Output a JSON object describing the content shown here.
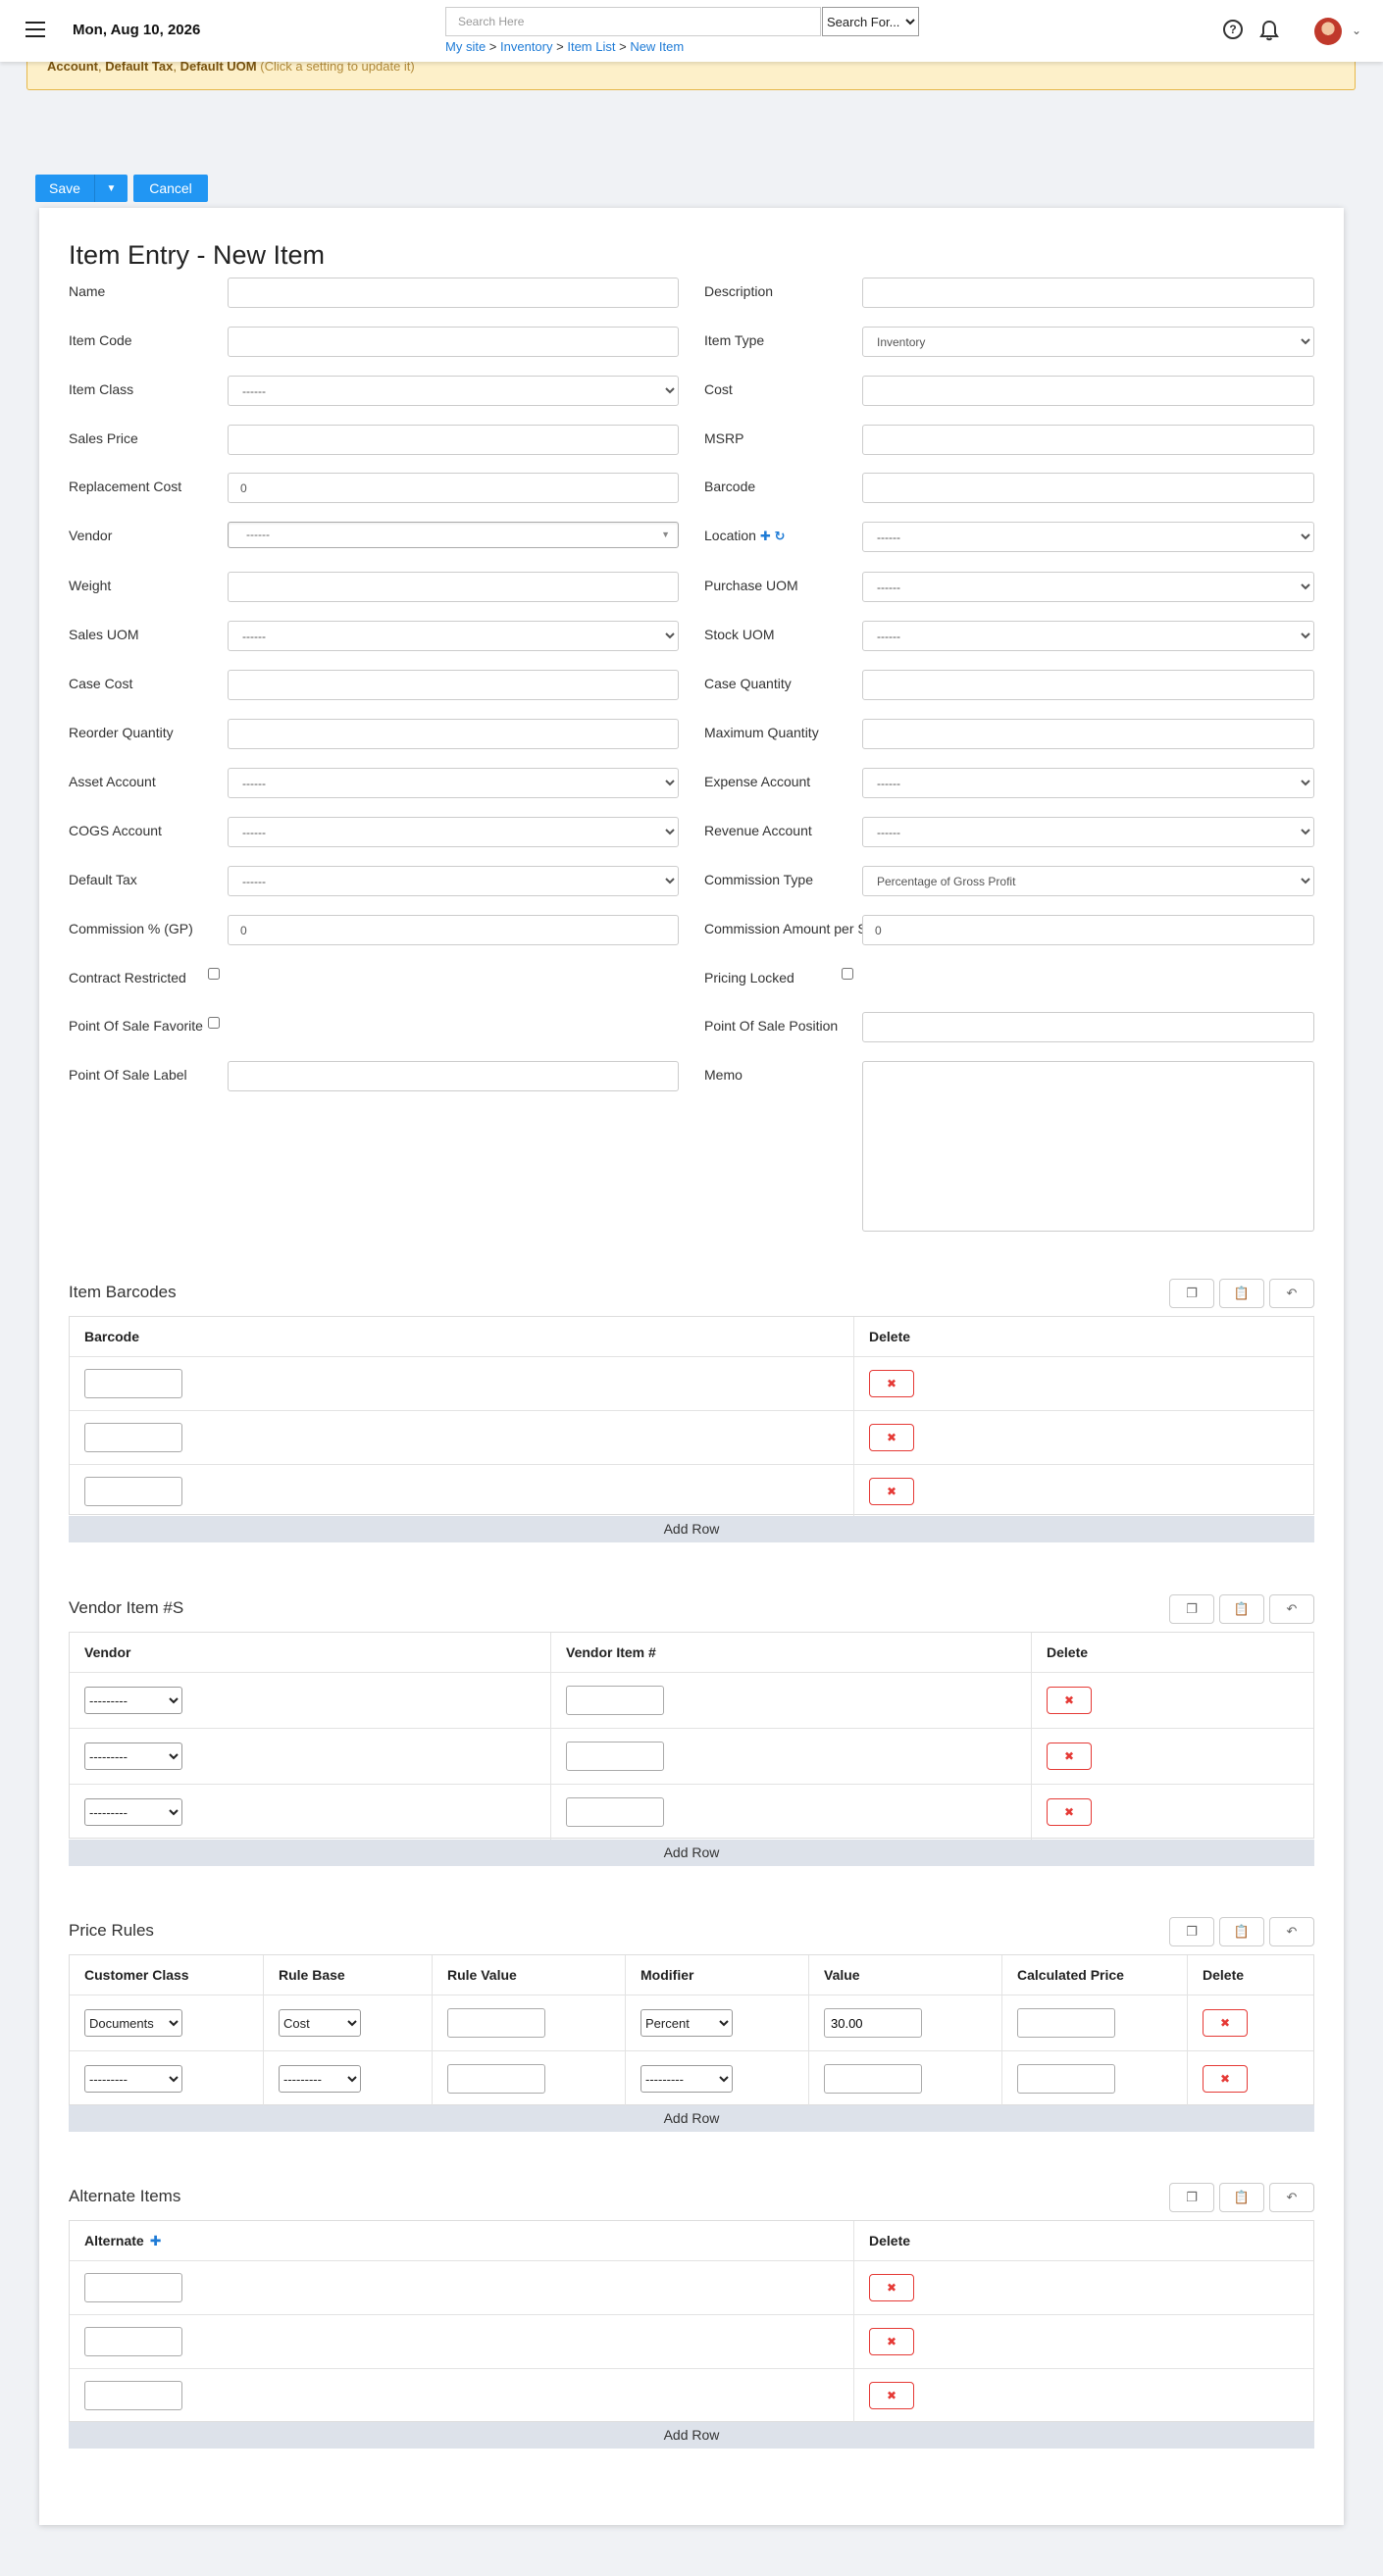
{
  "header": {
    "date": "Mon, Aug 10, 2026",
    "search_placeholder": "Search Here",
    "search_for_label": "Search For...",
    "breadcrumb": [
      "My site",
      "Inventory",
      "Item List",
      "New Item"
    ],
    "breadcrumb_sep": ">",
    "help_glyph": "?"
  },
  "alert": {
    "item1": "Account",
    "item2": "Default Tax",
    "item3": "Default UOM",
    "sep": ",",
    "hint": "(Click a setting to update it)"
  },
  "actions": {
    "save": "Save",
    "cancel": "Cancel"
  },
  "form": {
    "title": "Item Entry - New Item",
    "empty_option": "------",
    "left": {
      "name": "Name",
      "item_code": "Item Code",
      "item_class": "Item Class",
      "sales_price": "Sales Price",
      "replacement_cost": "Replacement Cost",
      "replacement_cost_value": "0",
      "vendor": "Vendor",
      "weight": "Weight",
      "sales_uom": "Sales UOM",
      "case_cost": "Case Cost",
      "reorder_quantity": "Reorder Quantity",
      "asset_account": "Asset Account",
      "cogs_account": "COGS Account",
      "default_tax": "Default Tax",
      "commission_gp": "Commission % (GP)",
      "commission_gp_value": "0",
      "contract_restricted": "Contract Restricted",
      "pos_favorite": "Point Of Sale Favorite",
      "pos_label": "Point Of Sale Label"
    },
    "right": {
      "description": "Description",
      "item_type": "Item Type",
      "item_type_value": "Inventory",
      "cost": "Cost",
      "msrp": "MSRP",
      "barcode": "Barcode",
      "location": "Location",
      "purchase_uom": "Purchase UOM",
      "stock_uom": "Stock UOM",
      "case_quantity": "Case Quantity",
      "maximum_quantity": "Maximum Quantity",
      "expense_account": "Expense Account",
      "revenue_account": "Revenue Account",
      "commission_type": "Commission Type",
      "commission_type_value": "Percentage of Gross Profit",
      "commission_amount": "Commission Amount per S",
      "commission_amount_value": "0",
      "pricing_locked": "Pricing Locked",
      "pos_position": "Point Of Sale Position",
      "memo": "Memo"
    }
  },
  "grids": {
    "add_row": "Add Row",
    "dash_option": "---------",
    "delete_glyph": "✖",
    "barcodes": {
      "title": "Item Barcodes",
      "col_barcode": "Barcode",
      "col_delete": "Delete"
    },
    "vendor_items": {
      "title": "Vendor Item #S",
      "col_vendor": "Vendor",
      "col_vendor_item": "Vendor Item #",
      "col_delete": "Delete"
    },
    "price_rules": {
      "title": "Price Rules",
      "col_customer_class": "Customer Class",
      "col_rule_base": "Rule Base",
      "col_rule_value": "Rule Value",
      "col_modifier": "Modifier",
      "col_value": "Value",
      "col_calculated_price": "Calculated Price",
      "col_delete": "Delete",
      "row1_customer_class": "Documents",
      "row1_rule_base": "Cost",
      "row1_modifier": "Percent",
      "row1_value": "30.00"
    },
    "alternates": {
      "title": "Alternate Items",
      "col_alternate": "Alternate",
      "col_delete": "Delete"
    }
  }
}
